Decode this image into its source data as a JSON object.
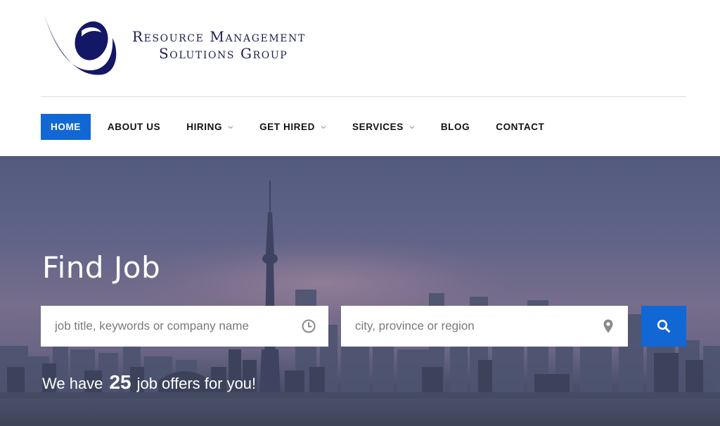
{
  "brand": {
    "line1": "Resource Management",
    "line2": "Solutions Group",
    "logo_icon": "rmsg-swoosh-logo",
    "color": "#1b1d55"
  },
  "nav": {
    "items": [
      {
        "label": "HOME",
        "active": true,
        "dropdown": false
      },
      {
        "label": "ABOUT US",
        "active": false,
        "dropdown": false
      },
      {
        "label": "HIRING",
        "active": false,
        "dropdown": true
      },
      {
        "label": "GET HIRED",
        "active": false,
        "dropdown": true
      },
      {
        "label": "SERVICES",
        "active": false,
        "dropdown": true
      },
      {
        "label": "BLOG",
        "active": false,
        "dropdown": false
      },
      {
        "label": "CONTACT",
        "active": false,
        "dropdown": false
      }
    ],
    "active_color": "#1167d4"
  },
  "hero": {
    "title": "Find Job",
    "keyword_search": {
      "placeholder": "job title, keywords or company name",
      "value": "",
      "icon": "clock-icon"
    },
    "location_search": {
      "placeholder": "city, province or region",
      "value": "",
      "icon": "map-pin-icon"
    },
    "search_button_icon": "search-icon",
    "offers_prefix": "We have",
    "offers_count": "25",
    "offers_suffix": "job offers for you!",
    "background": "toronto-skyline-dusk"
  }
}
